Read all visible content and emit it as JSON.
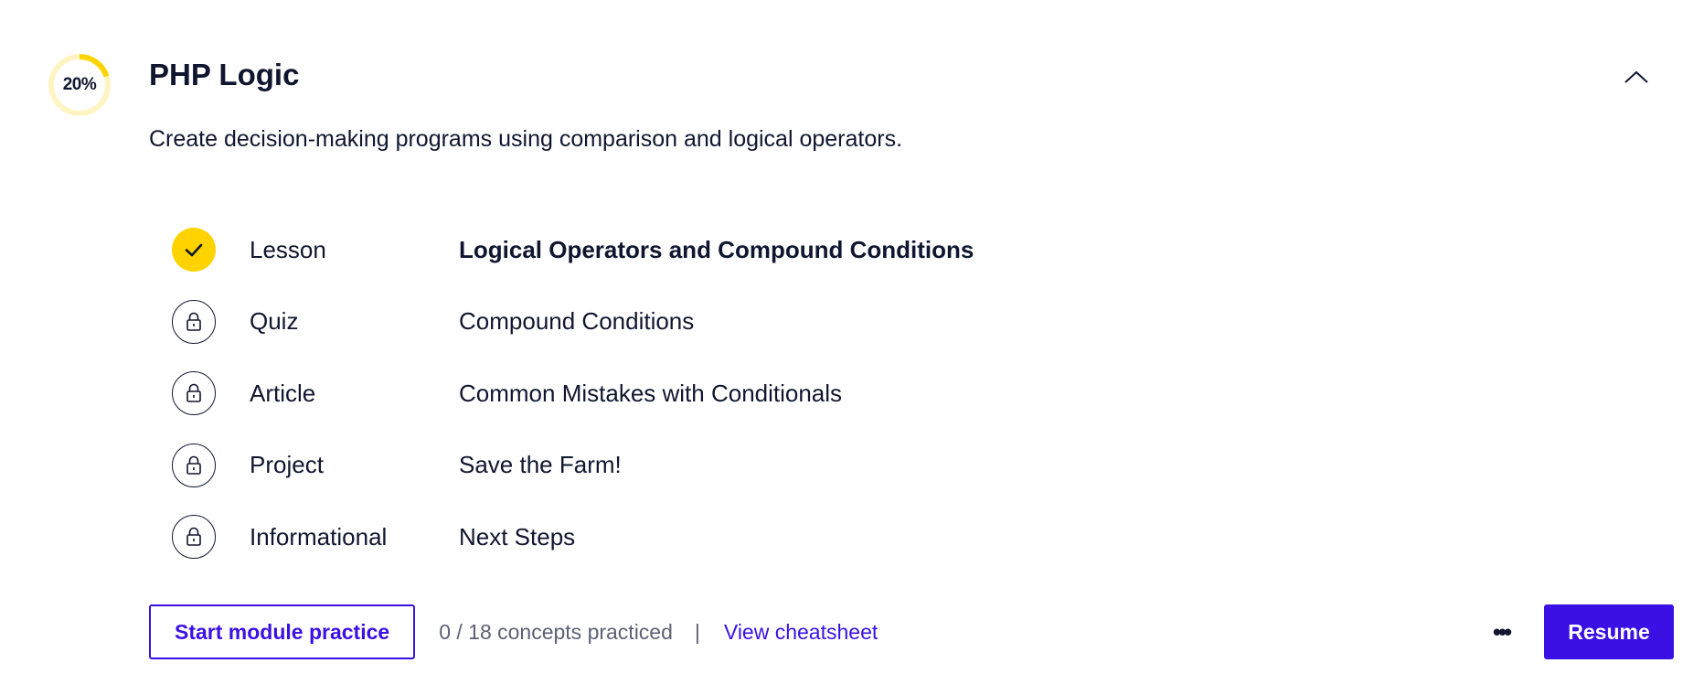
{
  "module": {
    "progress_label": "20%",
    "progress_value": 0.2,
    "title": "PHP Logic",
    "description": "Create decision-making programs using comparison and logical operators."
  },
  "items": [
    {
      "type": "Lesson",
      "name": "Logical Operators and Compound Conditions",
      "status": "completed",
      "icon": "checkmark-icon"
    },
    {
      "type": "Quiz",
      "name": "Compound Conditions",
      "status": "locked",
      "icon": "lock-icon"
    },
    {
      "type": "Article",
      "name": "Common Mistakes with Conditionals",
      "status": "locked",
      "icon": "lock-icon"
    },
    {
      "type": "Project",
      "name": "Save the Farm!",
      "status": "locked",
      "icon": "lock-icon"
    },
    {
      "type": "Informational",
      "name": "Next Steps",
      "status": "locked",
      "icon": "lock-icon"
    }
  ],
  "footer": {
    "practice_button": "Start module practice",
    "concepts_text": "0 / 18 concepts practiced",
    "separator": "|",
    "cheatsheet_link": "View cheatsheet",
    "more_icon": "ellipsis-icon",
    "more_label": "•••",
    "resume_button": "Resume"
  },
  "colors": {
    "accent": "#3a10e5",
    "progress": "#ffd300",
    "progress_track": "#fff4c2",
    "text": "#10162f",
    "muted": "#5d6174"
  }
}
